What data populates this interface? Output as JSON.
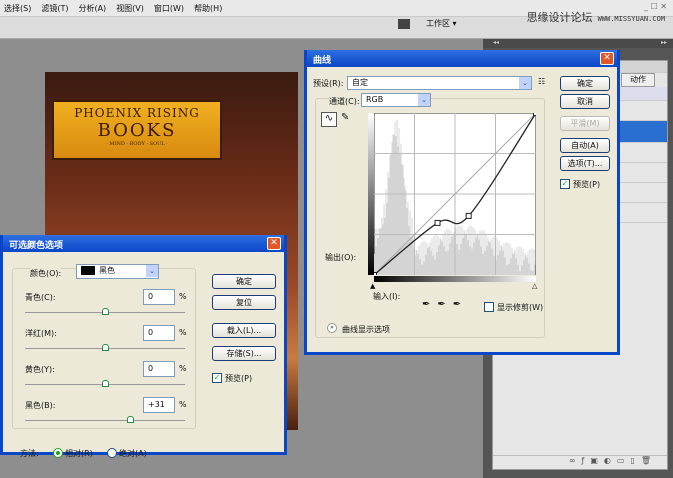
{
  "menu": [
    "选择(S)",
    "滤镜(T)",
    "分析(A)",
    "视图(V)",
    "窗口(W)",
    "帮助(H)"
  ],
  "workspace_label": "工作区 ▾",
  "brand": {
    "name": "思缘设计论坛",
    "url": "WWW.MISSYUAN.COM"
  },
  "window_controls": "_ ☐ ✕",
  "panel": {
    "tab": "动作",
    "collapse": "◂◂",
    "expand": "▸▸"
  },
  "photo": {
    "line1": "PHOENIX RISING",
    "line2": "BOOKS",
    "line3": "· MIND · BODY · SOUL ·"
  },
  "curves": {
    "title": "曲线",
    "close": "✕",
    "preset_label": "预设(R):",
    "preset_value": "自定",
    "channel_label": "通道(C):",
    "channel_value": "RGB",
    "output_label": "输出(O):",
    "input_label": "输入(I):",
    "show_clipping": "显示修剪(W)",
    "display_options": "曲线显示选项",
    "buttons": {
      "ok": "确定",
      "cancel": "取消",
      "smooth": "平滑(M)",
      "auto": "自动(A)",
      "options": "选项(T)..."
    },
    "preview": "预览(P)",
    "preview_checked": true,
    "points": [
      [
        0,
        0
      ],
      [
        100,
        82
      ],
      [
        149,
        93
      ],
      [
        255,
        255
      ]
    ]
  },
  "selective": {
    "title": "可选颜色选项",
    "close": "✕",
    "color_label": "颜色(O):",
    "color_value": "黑色",
    "sliders": [
      {
        "label": "青色(C):",
        "value": "0",
        "pct": 50
      },
      {
        "label": "洋红(M):",
        "value": "0",
        "pct": 50
      },
      {
        "label": "黄色(Y):",
        "value": "0",
        "pct": 50
      },
      {
        "label": "黑色(B):",
        "value": "+31",
        "pct": 65.5
      }
    ],
    "unit": "%",
    "buttons": {
      "ok": "确定",
      "reset": "复位",
      "load": "载入(L)...",
      "save": "存储(S)..."
    },
    "preview": "预览(P)",
    "method_label": "方法:",
    "relative": "相对(R)",
    "absolute": "绝对(A)",
    "method": "relative"
  }
}
